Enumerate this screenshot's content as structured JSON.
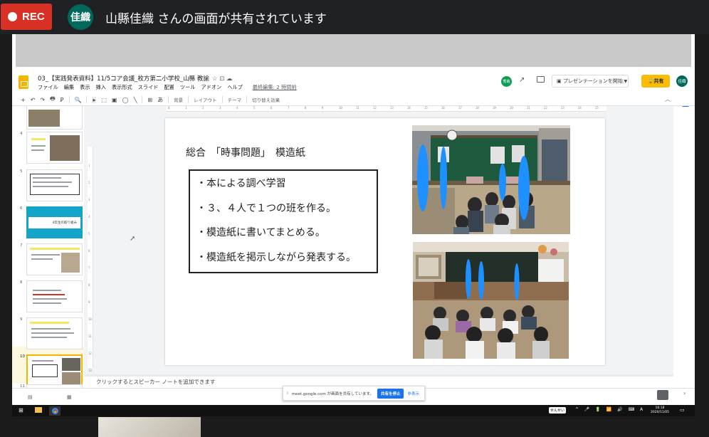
{
  "meet": {
    "rec_label": "REC",
    "presenter_initials": "佳織",
    "share_message": "山縣佳織 さんの画面が共有されています"
  },
  "docs": {
    "title": "03_【実践発表資料】11/5コア会議_枚方第二小学校_山縣 教諭",
    "title_icons": "☆ ⊡ ☁",
    "menus": [
      "ファイル",
      "編集",
      "表示",
      "挿入",
      "表示形式",
      "スライド",
      "配置",
      "ツール",
      "アドオン",
      "ヘルプ"
    ],
    "last_edit": "最終編集: 2 時間前",
    "collaborator_initials": "秀哉",
    "present_label": "プレゼンテーションを開始",
    "share_label": "共有",
    "user_initials": "佳織"
  },
  "toolbar": {
    "items": [
      "+",
      "↶",
      "↷",
      "🖶",
      "Ꝑ",
      "🔍",
      "▸",
      "⬚",
      "▣",
      "◯",
      "╲",
      "⊞",
      "あ",
      "背景",
      "レイアウト",
      "テーマ",
      "切り替え効果"
    ]
  },
  "filmstrip": {
    "slide_numbers": [
      "4",
      "5",
      "6",
      "7",
      "8",
      "9",
      "10",
      "11"
    ],
    "slide6_text": "4年生の取り組み",
    "selected": "10"
  },
  "slide": {
    "title": "総合　「時事問題」　模造紙",
    "bullets": [
      "・本による調べ学習",
      "・３、４人で１つの班を作る。",
      "・模造紙に書いてまとめる。",
      "・模造紙を掲示しながら発表する。"
    ]
  },
  "notes": {
    "placeholder": "クリックするとスピーカー ノートを追加できます"
  },
  "sharing_banner": {
    "message": "meet.google.com が画面を共有しています。",
    "stop_label": "共有を停止",
    "hide_label": "非表示"
  },
  "taskbar": {
    "ime_label": "せんせい",
    "tray": "^ 🎤 🔋 📶 🔊 ⌨ A",
    "time": "16:18",
    "date": "2020/11/05"
  },
  "colors": {
    "rec_red": "#d93025",
    "presenter_teal": "#00695c",
    "share_yellow": "#fbbc04",
    "stop_share_blue": "#1a73e8",
    "censor_blue": "#1e90ff"
  }
}
